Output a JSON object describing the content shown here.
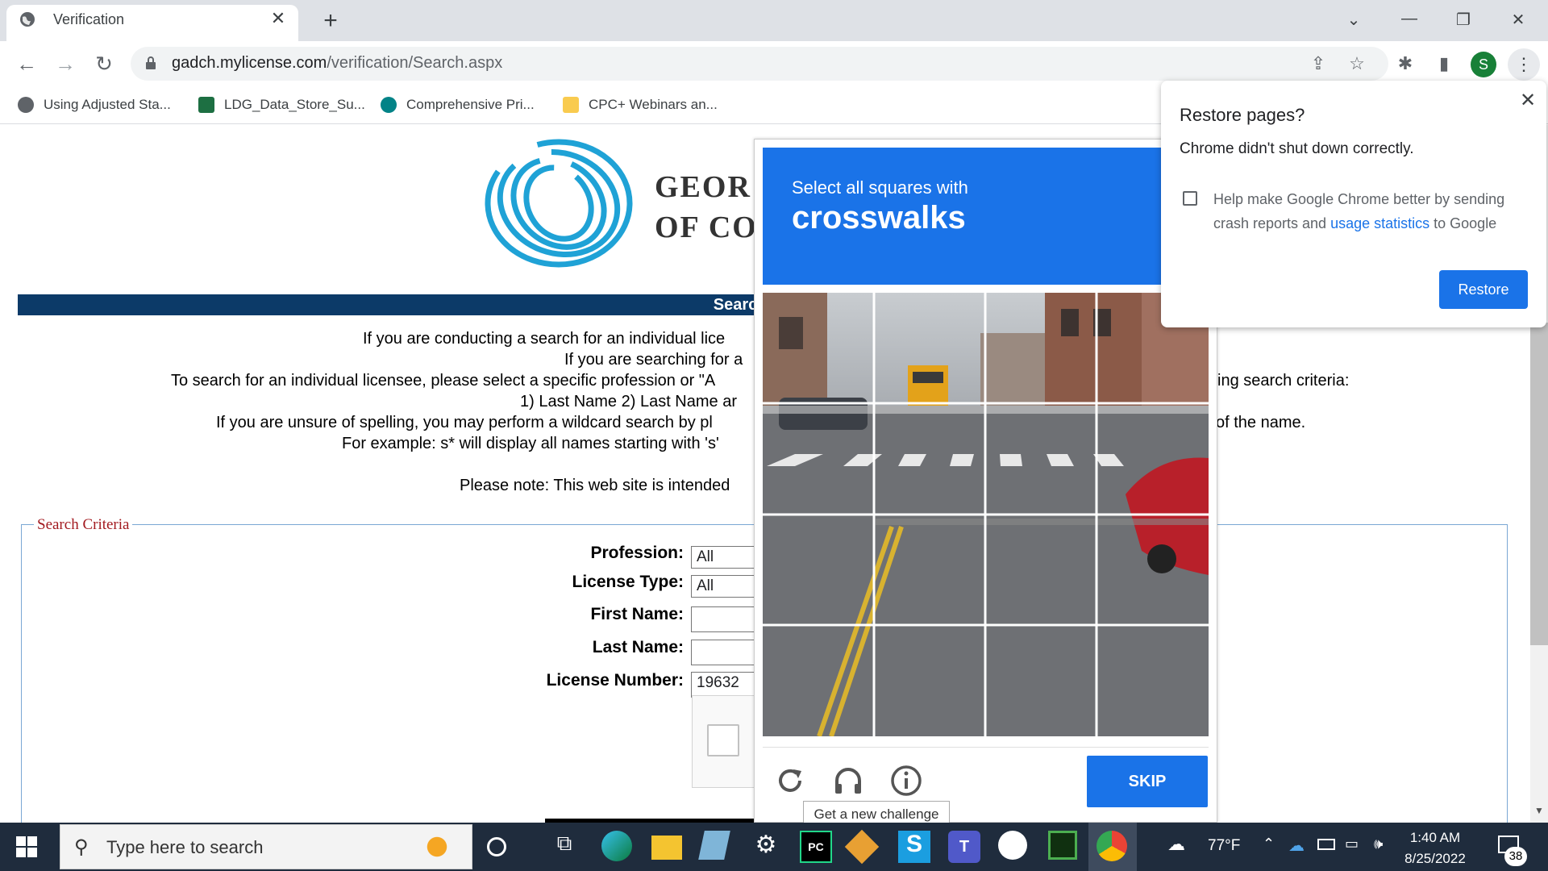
{
  "browser": {
    "tab_title": "Verification",
    "url_domain": "gadch.mylicense.com",
    "url_path": "/verification/Search.aspx",
    "profile_initial": "S",
    "bookmarks": [
      {
        "label": "Using Adjusted Sta...",
        "icon": "globe-icon"
      },
      {
        "label": "LDG_Data_Store_Su...",
        "icon": "excel-icon"
      },
      {
        "label": "Comprehensive Pri...",
        "icon": "sharepoint-icon"
      },
      {
        "label": "CPC+ Webinars an...",
        "icon": "folder-icon"
      }
    ]
  },
  "page": {
    "org_line1": "GEOR",
    "org_line2": "OF CO",
    "search_bar": "Search for a Pro",
    "intro": [
      "If you are conducting a search for an individual lice",
      "If you are searching for a",
      "To search for an individual licensee, please select a specific profession or \"A",
      "1) Last Name 2) Last Name ar",
      "If you are unsure of spelling, you may perform a wildcard search by pl",
      "For example: s* will display all names starting with 's'",
      "Please note: This web site is intended"
    ],
    "intro_right": [
      "ing search criteria:",
      "of the name."
    ],
    "legend": "Search Criteria",
    "fields": {
      "profession_label": "Profession:",
      "profession_value": "All",
      "license_type_label": "License Type:",
      "license_type_value": "All",
      "first_name_label": "First Name:",
      "first_name_value": "",
      "last_name_label": "Last Name:",
      "last_name_value": "",
      "license_number_label": "License Number:",
      "license_number_value": "19632"
    }
  },
  "captcha": {
    "line1": "Select all squares with",
    "line2": "crosswalks",
    "skip_label": "SKIP",
    "tooltip": "Get a new challenge"
  },
  "restore_dialog": {
    "title": "Restore pages?",
    "message": "Chrome didn't shut down correctly.",
    "checkbox_text_before": "Help make Google Chrome better by sending crash reports and ",
    "checkbox_link": "usage statistics",
    "checkbox_text_after": " to Google",
    "button": "Restore"
  },
  "taskbar": {
    "search_placeholder": "Type here to search",
    "weather": "77°F",
    "time": "1:40 AM",
    "date": "8/25/2022",
    "notification_count": "38"
  },
  "colors": {
    "chrome_blue": "#1a73e8",
    "banner_navy": "#0c3a68",
    "legend_red": "#a2191f",
    "logo_blue": "#1fa2d6"
  }
}
